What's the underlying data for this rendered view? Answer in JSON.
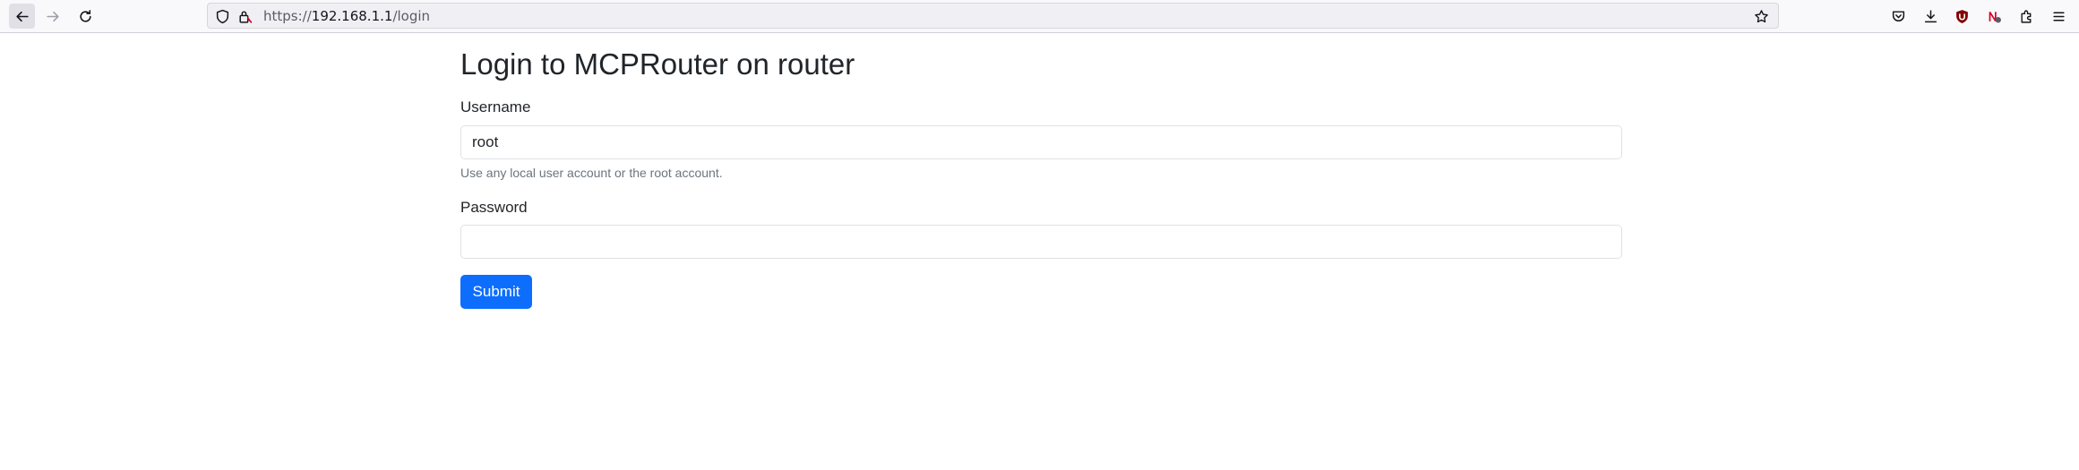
{
  "browser": {
    "url_scheme": "https://",
    "url_host": "192.168.1.1",
    "url_path": "/login",
    "icons": {
      "back": "arrow-left-icon",
      "forward": "arrow-right-icon",
      "reload": "reload-icon",
      "tracking": "shield-icon",
      "security": "lock-icon",
      "bookmark": "star-icon",
      "pocket": "pocket-icon",
      "downloads": "download-icon",
      "ublock": "ublock-icon",
      "extension_n": "extension-n-icon",
      "extensions": "puzzle-icon",
      "menu": "hamburger-menu-icon"
    }
  },
  "login": {
    "title": "Login to MCPRouter on router",
    "username_label": "Username",
    "username_value": "root",
    "username_help": "Use any local user account or the root account.",
    "password_label": "Password",
    "password_value": "",
    "submit_label": "Submit"
  },
  "colors": {
    "primary": "#0d6efd",
    "muted_text": "#6c757d",
    "ublock_red": "#800000"
  }
}
